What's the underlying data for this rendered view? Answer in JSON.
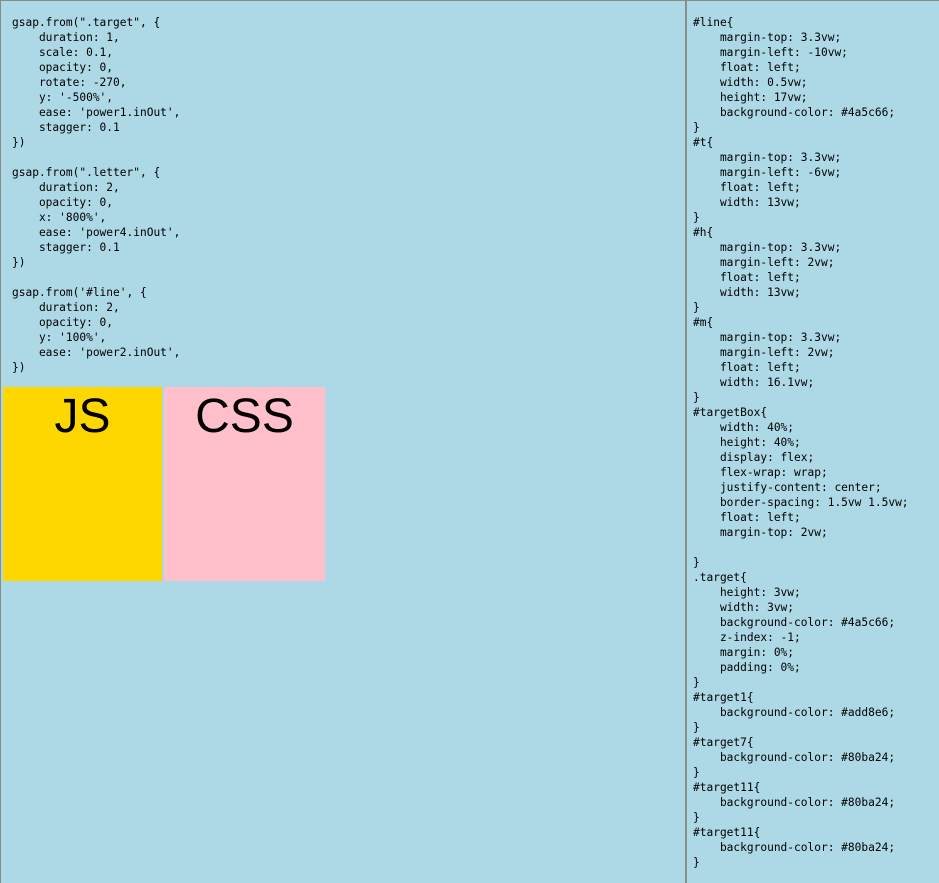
{
  "colors": {
    "page_background": "#add8e6",
    "divider": "#8c8c8c",
    "js_box": "#ffd700",
    "css_box": "#ffc0cb"
  },
  "left_pane": {
    "js_code": "gsap.from(\".target\", {\n    duration: 1,\n    scale: 0.1,\n    opacity: 0,\n    rotate: -270,\n    y: '-500%',\n    ease: 'power1.inOut',\n    stagger: 0.1\n})\n\ngsap.from(\".letter\", {\n    duration: 2,\n    opacity: 0,\n    x: '800%',\n    ease: 'power4.inOut',\n    stagger: 0.1\n})\n\ngsap.from('#line', {\n    duration: 2,\n    opacity: 0,\n    y: '100%',\n    ease: 'power2.inOut',\n})",
    "boxes": [
      {
        "label": "JS"
      },
      {
        "label": "CSS"
      }
    ]
  },
  "right_pane": {
    "css_code": "#line{\n    margin-top: 3.3vw;\n    margin-left: -10vw;\n    float: left;\n    width: 0.5vw;\n    height: 17vw;\n    background-color: #4a5c66;\n}\n#t{\n    margin-top: 3.3vw;\n    margin-left: -6vw;\n    float: left;\n    width: 13vw;\n}\n#h{\n    margin-top: 3.3vw;\n    margin-left: 2vw;\n    float: left;\n    width: 13vw;\n}\n#m{\n    margin-top: 3.3vw;\n    margin-left: 2vw;\n    float: left;\n    width: 16.1vw;\n}\n#targetBox{\n    width: 40%;\n    height: 40%;\n    display: flex;\n    flex-wrap: wrap;\n    justify-content: center;\n    border-spacing: 1.5vw 1.5vw;\n    float: left;\n    margin-top: 2vw;\n\n}\n.target{\n    height: 3vw;\n    width: 3vw;\n    background-color: #4a5c66;\n    z-index: -1;\n    margin: 0%;\n    padding: 0%;\n}\n#target1{\n    background-color: #add8e6;\n}\n#target7{\n    background-color: #80ba24;\n}\n#target11{\n    background-color: #80ba24;\n}\n#target11{\n    background-color: #80ba24;\n}"
  }
}
